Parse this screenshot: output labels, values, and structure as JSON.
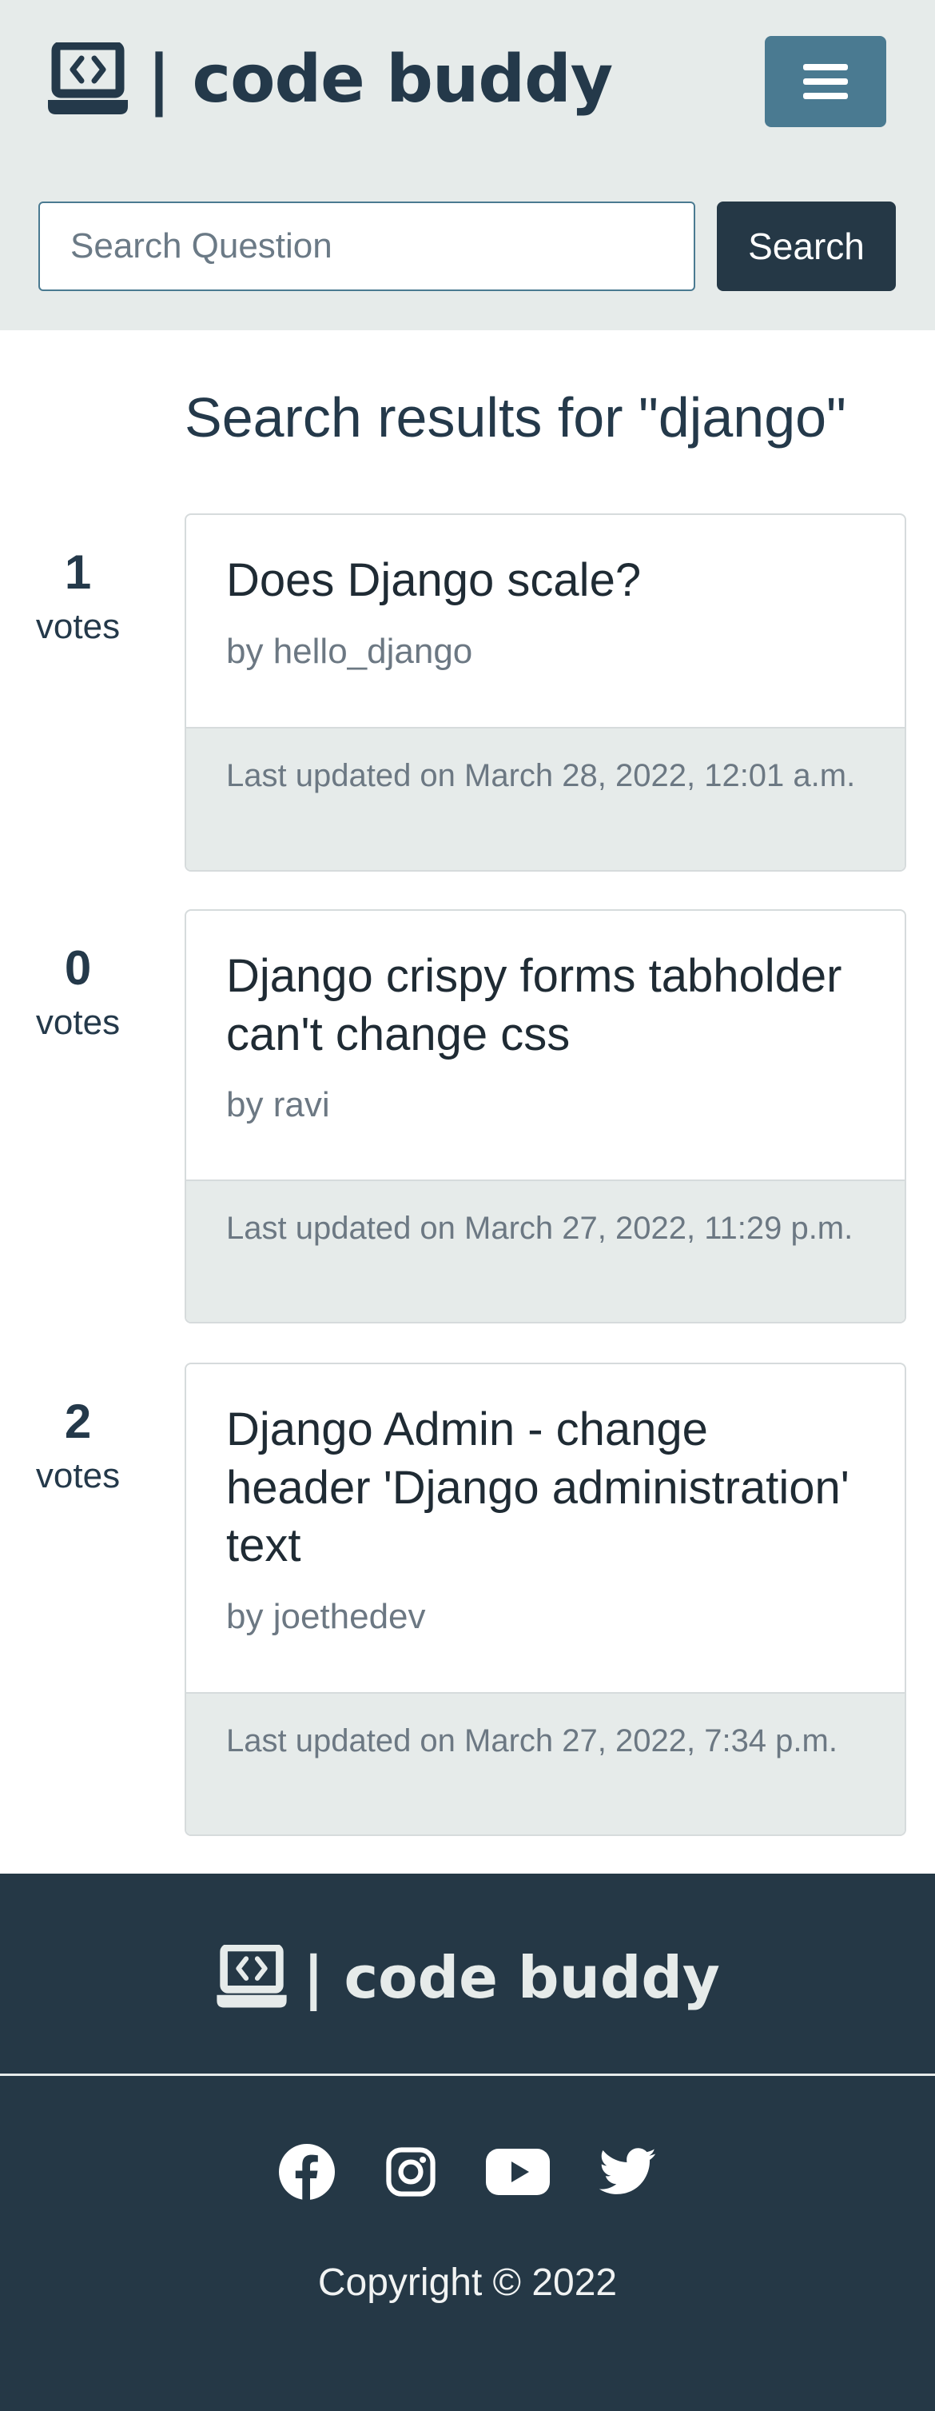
{
  "header": {
    "brand_text": "| code buddy",
    "logo_icon": "laptop-code-icon",
    "menu_icon": "hamburger-menu-icon",
    "menu_button_color": "#4a7a91",
    "background": "#e6ebea"
  },
  "search": {
    "placeholder": "Search Question",
    "value": "",
    "button_label": "Search"
  },
  "main": {
    "title": "Search results for \"django\"",
    "results": [
      {
        "votes": "1",
        "votes_label": "votes",
        "title": "Does Django scale?",
        "author": "by hello_django",
        "updated": "Last updated on March 28, 2022, 12:01 a.m."
      },
      {
        "votes": "0",
        "votes_label": "votes",
        "title": "Django crispy forms tabholder can't change css",
        "author": "by ravi",
        "updated": "Last updated on March 27, 2022, 11:29 p.m."
      },
      {
        "votes": "2",
        "votes_label": "votes",
        "title": "Django Admin - change header 'Django administration' text",
        "author": "by joethedev",
        "updated": "Last updated on March 27, 2022, 7:34 p.m."
      }
    ]
  },
  "footer": {
    "brand_text": "| code buddy",
    "social": [
      "facebook-icon",
      "instagram-icon",
      "youtube-icon",
      "twitter-icon"
    ],
    "copyright": "Copyright © 2022",
    "background": "#253846"
  }
}
